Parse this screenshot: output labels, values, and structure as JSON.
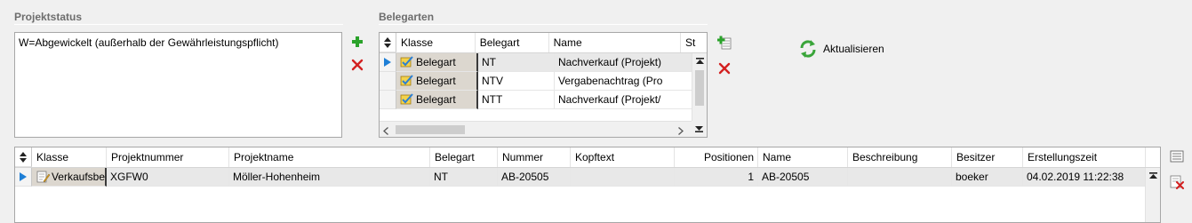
{
  "projektstatus": {
    "title": "Projektstatus",
    "value": "W=Abgewickelt (außerhalb der Gewährleistungspflicht)",
    "add_icon": "plus-icon",
    "remove_icon": "delete-x-icon"
  },
  "belegarten": {
    "title": "Belegarten",
    "columns": [
      "Klasse",
      "Belegart",
      "Name",
      "St"
    ],
    "rows": [
      {
        "klasse": "Belegart",
        "belegart": "NT",
        "name": "Nachverkauf (Projekt)"
      },
      {
        "klasse": "Belegart",
        "belegart": "NTV",
        "name": "Vergabenachtrag (Pro"
      },
      {
        "klasse": "Belegart",
        "belegart": "NTT",
        "name": "Nachverkauf (Projekt/"
      }
    ],
    "add_icon": "add-row-icon",
    "remove_icon": "delete-x-icon"
  },
  "refresh": {
    "label": "Aktualisieren",
    "icon": "refresh-icon"
  },
  "projects": {
    "columns": [
      "Klasse",
      "Projektnummer",
      "Projektname",
      "Belegart",
      "Nummer",
      "Kopftext",
      "Positionen",
      "Name",
      "Beschreibung",
      "Besitzer",
      "Erstellungszeit"
    ],
    "rows": [
      {
        "klasse": "Verkaufsbe",
        "projektnummer": "XGFW0",
        "projektname": "Möller-Hohenheim",
        "belegart": "NT",
        "nummer": "AB-20505",
        "kopftext": "",
        "positionen": "1",
        "name": "AB-20505",
        "beschreibung": "",
        "besitzer": "boeker",
        "erstellungszeit": "04.02.2019 11:22:38"
      }
    ]
  },
  "colors": {
    "accent_blue": "#1e7fd6",
    "plus_green": "#2aa22a",
    "delete_red": "#d32020",
    "selected_row": "#e8e8e8",
    "klasse_cell": "#dcd7cf"
  }
}
